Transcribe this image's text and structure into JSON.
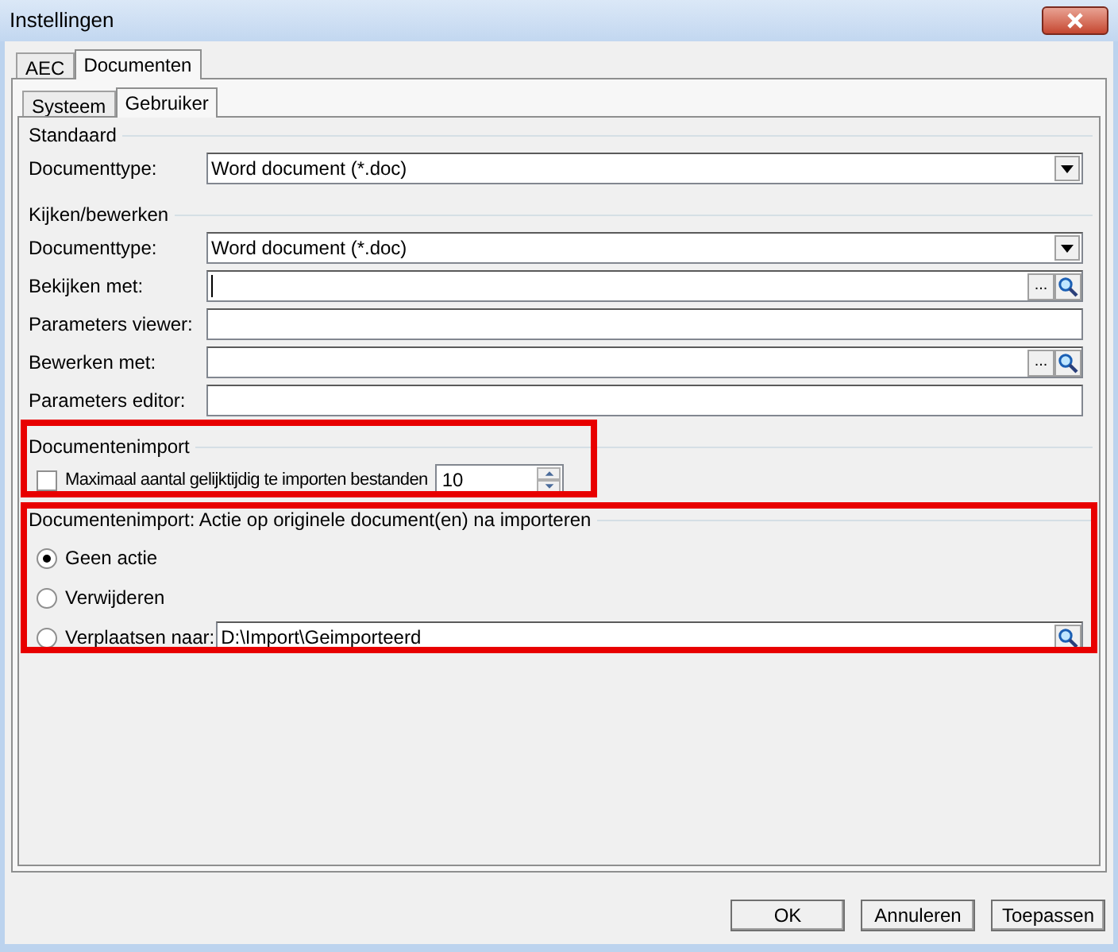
{
  "window": {
    "title": "Instellingen"
  },
  "tabs": [
    {
      "label": "AEC",
      "selected": false
    },
    {
      "label": "Documenten",
      "selected": true
    }
  ],
  "subtabs": [
    {
      "label": "Systeem",
      "selected": false
    },
    {
      "label": "Gebruiker",
      "selected": true
    }
  ],
  "groups": [
    {
      "title": "Standaard",
      "rows": [
        {
          "kind": "dropdown",
          "label": "Documenttype:",
          "value": "Word document (*.doc)"
        }
      ]
    },
    {
      "title": "Kijken/bewerken",
      "rows": [
        {
          "kind": "dropdown",
          "label": "Documenttype:",
          "value": "Word document (*.doc)"
        },
        {
          "kind": "browse",
          "label": "Bekijken met:",
          "focused": true,
          "button_label": "..."
        },
        {
          "kind": "text",
          "label": "Parameters viewer:"
        },
        {
          "kind": "browse",
          "label": "Bewerken met:",
          "focused": false,
          "button_label": "..."
        },
        {
          "kind": "text",
          "label": "Parameters editor:"
        }
      ]
    }
  ],
  "import": {
    "title": "Documentenimport",
    "checkbox": {
      "label": "Maximaal aantal gelijktijdig te importen bestanden",
      "checked": false
    },
    "spinner": {
      "value": "10"
    }
  },
  "action": {
    "title": "Documentenimport: Actie op originele document(en) na importeren",
    "options": [
      {
        "label": "Geen actie",
        "selected": true
      },
      {
        "label": "Verwijderen",
        "selected": false
      },
      {
        "label": "Verplaatsen naar:",
        "selected": false,
        "field_value": "D:\\Import\\Geimporteerd"
      }
    ]
  },
  "buttons": [
    "OK",
    "Annuleren",
    "Toepassen"
  ]
}
